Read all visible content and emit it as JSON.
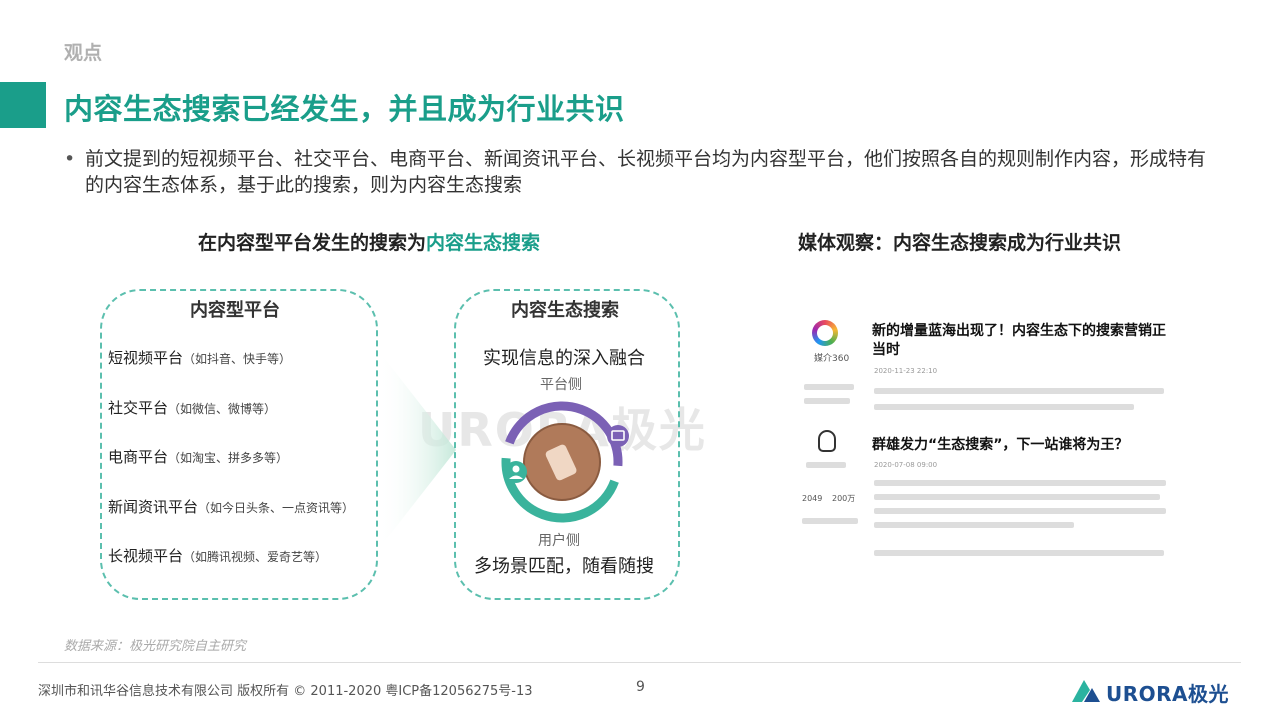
{
  "section_tag": "观点",
  "title": "内容生态搜索已经发生，并且成为行业共识",
  "bullet": "前文提到的短视频平台、社交平台、电商平台、新闻资讯平台、长视频平台均为内容型平台，他们按照各自的规则制作内容，形成特有的内容生态体系，基于此的搜索，则为内容生态搜索",
  "left_heading": {
    "prefix": "在内容型平台发生的搜索为",
    "highlight": "内容生态搜索"
  },
  "right_heading": "媒体观察：内容生态搜索成为行业共识",
  "platform_box": {
    "title": "内容型平台",
    "items": [
      {
        "name": "短视频平台",
        "note": "（如抖音、快手等）"
      },
      {
        "name": "社交平台",
        "note": "（如微信、微博等）"
      },
      {
        "name": "电商平台",
        "note": "（如淘宝、拼多多等）"
      },
      {
        "name": "新闻资讯平台",
        "note": "（如今日头条、一点资讯等）"
      },
      {
        "name": "长视频平台",
        "note": "（如腾讯视频、爱奇艺等）"
      }
    ]
  },
  "search_box": {
    "title": "内容生态搜索",
    "deep_fusion": "实现信息的深入融合",
    "platform_side": "平台侧",
    "user_side": "用户侧",
    "multi_scene": "多场景匹配，随看随搜"
  },
  "watermark": "URORA极光",
  "news": {
    "headline1": "新的增量蓝海出现了！内容生态下的搜索营销正当时",
    "source1": "媒介360",
    "date1": "2020-11-23 22:10",
    "headline2": "群雄发力“生态搜索”，下一站谁将为王？",
    "date2": "2020-07-08 09:00",
    "stat1": "2049",
    "stat2": "200万"
  },
  "source_note": "数据来源：极光研究院自主研究",
  "footer": "深圳市和讯华谷信息技术有限公司 版权所有 © 2011-2020 粤ICP备12056275号-13",
  "page_number": "9",
  "brand": "URORA极光",
  "colors": {
    "accent": "#1a9e8a",
    "brand": "#1d4f91",
    "ring_top": "#7b61b5",
    "ring_bottom": "#3ab39c"
  }
}
